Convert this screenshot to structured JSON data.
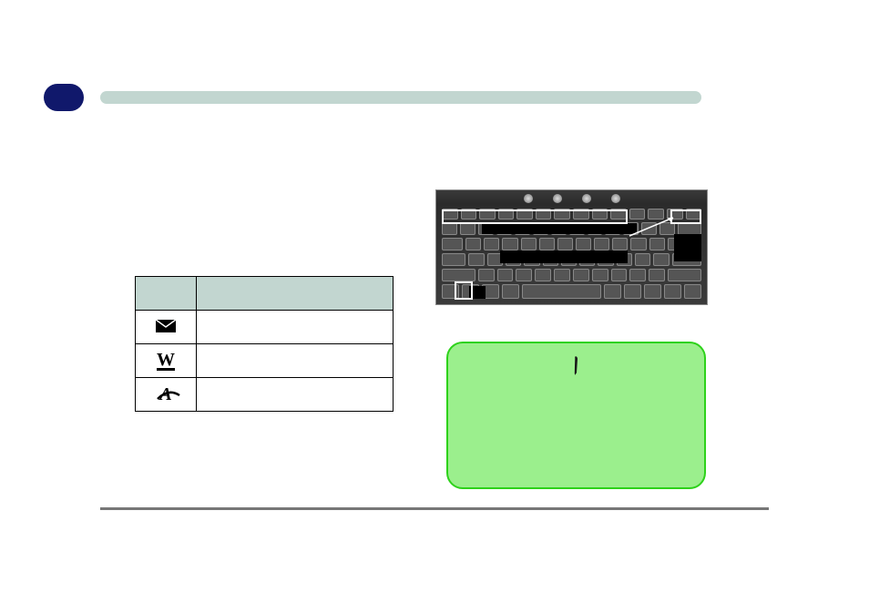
{
  "header": {
    "badge_text": "",
    "bar_text": ""
  },
  "section_title": "",
  "body_text": "",
  "table": {
    "headers": [
      "",
      ""
    ],
    "rows": [
      {
        "icon": "envelope-icon",
        "glyph": "✉",
        "desc": ""
      },
      {
        "icon": "www-icon",
        "glyph": "W",
        "desc": ""
      },
      {
        "icon": "app-icon",
        "glyph": "A",
        "desc": ""
      }
    ]
  },
  "figure": {
    "alt": "Keyboard with Fn combination keys highlighted",
    "highlight_labels": []
  },
  "tip": {
    "icon": "pen-icon",
    "title": "",
    "body": ""
  },
  "page_number": ""
}
